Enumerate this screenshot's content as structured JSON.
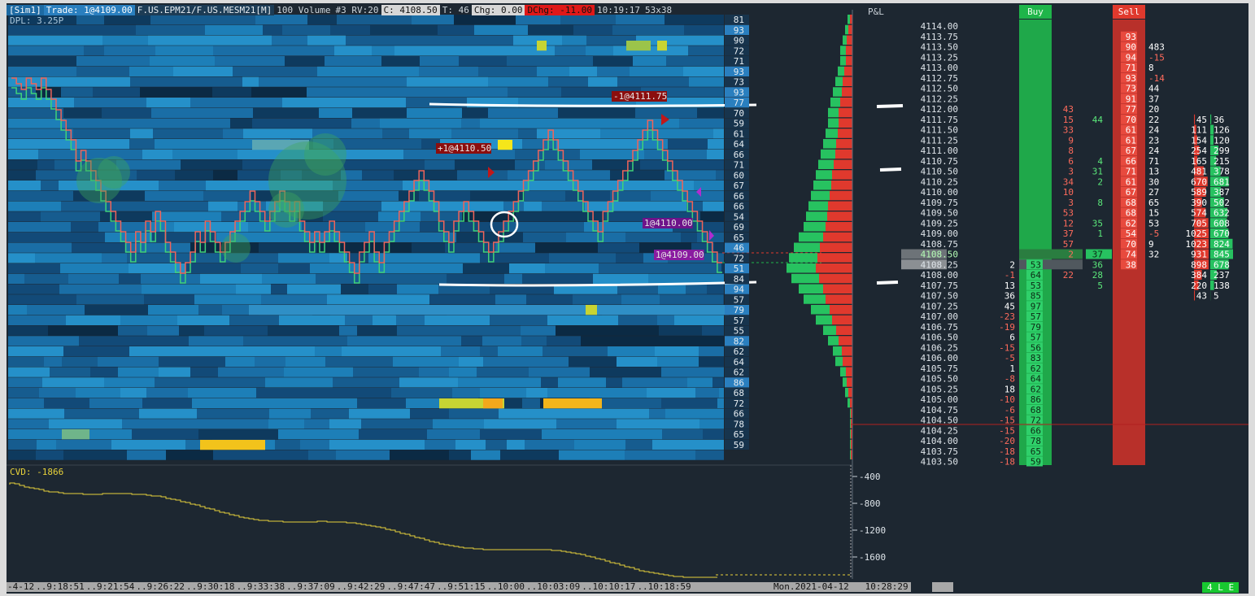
{
  "header": {
    "sim": "[Sim1]",
    "trade": "Trade: 1@4109.00",
    "symbol": "F.US.EPM21/F.US.MESM21[M]",
    "volume": "100 Volume",
    "rv": "#3 RV:20",
    "close": "C: 4108.50",
    "t": "T: 46",
    "chg": "Chg: 0.00",
    "dchg": "DChg: -11.00",
    "time": "10:19:17",
    "grid": "53x38",
    "dpl": "DPL: 3.25P"
  },
  "columns": {
    "pnl": "P&L",
    "buy": "Buy",
    "sell": "Sell"
  },
  "cvd_label": "CVD: -1866",
  "cvd_axis": [
    "-400",
    "-800",
    "-1200",
    "-1600"
  ],
  "right_axis": [
    "81",
    "93",
    "90",
    "72",
    "71",
    "93",
    "73",
    "93",
    "77",
    "70",
    "59",
    "61",
    "64",
    "66",
    "71",
    "60",
    "67",
    "66",
    "66",
    "54",
    "69",
    "65",
    "46",
    "72",
    "51",
    "84",
    "94",
    "57",
    "79",
    "57",
    "55",
    "82",
    "62",
    "64",
    "62",
    "86",
    "68",
    "72",
    "66",
    "78",
    "65",
    "59"
  ],
  "time_axis": [
    "-4-12",
    "9:18:51",
    "9:21:54",
    "9:26:22",
    "9:30:18",
    "9:33:38",
    "9:37:09",
    "9:42:29",
    "9:47:47",
    "9:51:15",
    "10:00",
    "10:03:09",
    "10:10:17",
    "10:18:59"
  ],
  "date_label": "Mon.2021-04-12   10:28:29",
  "status": "4 L E",
  "flags": [
    {
      "text": "-1@4111.75",
      "color": "#8b0e0e"
    },
    {
      "text": "+1@4110.50",
      "color": "#8b0e0e"
    },
    {
      "text": "1@4110.00",
      "color": "#6e138a"
    },
    {
      "text": "1@4109.00",
      "color": "#8a1ba0"
    }
  ],
  "ladder": {
    "prices": [
      "4114.00",
      "4113.75",
      "4113.50",
      "4113.25",
      "4113.00",
      "4112.75",
      "4112.50",
      "4112.25",
      "4112.00",
      "4111.75",
      "4111.50",
      "4111.25",
      "4111.00",
      "4110.75",
      "4110.50",
      "4110.25",
      "4110.00",
      "4109.75",
      "4109.50",
      "4109.25",
      "4109.00",
      "4108.75",
      "4108.50",
      "4108.25",
      "4108.00",
      "4107.75",
      "4107.50",
      "4107.25",
      "4107.00",
      "4106.75",
      "4106.50",
      "4106.25",
      "4106.00",
      "4105.75",
      "4105.50",
      "4105.25",
      "4105.00",
      "4104.75",
      "4104.50",
      "4104.25",
      "4104.00",
      "4103.75",
      "4103.50"
    ],
    "pnl": [
      "",
      "",
      "",
      "",
      "",
      "",
      "",
      "",
      "",
      "",
      "",
      "",
      "",
      "",
      "",
      "",
      "",
      "",
      "",
      "",
      "",
      "",
      "",
      "2",
      "-1",
      "13",
      "36",
      "45",
      "-23",
      "-19",
      "6",
      "-15",
      "-5",
      "1",
      "-8",
      "18",
      "-10",
      "-6",
      "-15",
      "-15",
      "-20",
      "-18",
      "-18"
    ],
    "bid": [
      "",
      "",
      "",
      "",
      "",
      "",
      "",
      "",
      "",
      "",
      "",
      "",
      "",
      "",
      "",
      "",
      "",
      "",
      "",
      "",
      "",
      "",
      "",
      "53",
      "64",
      "53",
      "85",
      "97",
      "57",
      "79",
      "57",
      "56",
      "83",
      "62",
      "64",
      "62",
      "86",
      "68",
      "72",
      "66",
      "78",
      "65",
      "59"
    ],
    "sold": [
      "",
      "",
      "",
      "",
      "",
      "",
      "",
      "",
      "43",
      "15",
      "33",
      "9",
      "8",
      "6",
      "3",
      "34",
      "10",
      "3",
      "53",
      "12",
      "37",
      "57",
      "2",
      "",
      "22",
      "",
      "",
      "",
      "",
      "",
      "",
      "",
      "",
      "",
      "",
      "",
      "",
      "",
      "",
      "",
      "",
      "",
      ""
    ],
    "bought": [
      "",
      "",
      "",
      "",
      "",
      "",
      "",
      "",
      "",
      "44",
      "",
      "",
      "",
      "4",
      "31",
      "2",
      "",
      "8",
      "",
      "35",
      "1",
      "",
      "37",
      "36",
      "28",
      "5",
      "",
      "",
      "",
      "",
      "",
      "",
      "",
      "",
      "",
      "",
      "",
      "",
      "",
      "",
      "",
      "",
      ""
    ],
    "ask": [
      "",
      "93",
      "90",
      "94",
      "71",
      "93",
      "73",
      "91",
      "77",
      "70",
      "61",
      "61",
      "67",
      "66",
      "71",
      "61",
      "67",
      "68",
      "68",
      "62",
      "54",
      "70",
      "74",
      "38",
      "",
      "",
      "",
      "",
      "",
      "",
      "",
      "",
      "",
      "",
      "",
      "",
      "",
      "",
      "",
      "",
      "",
      "",
      ""
    ],
    "vol": [
      "",
      "",
      "483",
      "-15",
      "8",
      "-14",
      "44",
      "37",
      "20",
      "22",
      "24",
      "23",
      "24",
      "71",
      "13",
      "30",
      "27",
      "65",
      "15",
      "53",
      "-5",
      "9",
      "32",
      "",
      "",
      "",
      "",
      "",
      "",
      "",
      "",
      "",
      "",
      "",
      "",
      "",
      "",
      "",
      "",
      "",
      "",
      "",
      ""
    ],
    "vp_a": [
      "",
      "",
      "",
      "",
      "",
      "",
      "",
      "",
      "",
      "45",
      "111",
      "154",
      "254",
      "165",
      "481",
      "670",
      "589",
      "390",
      "574",
      "705",
      "1025",
      "1023",
      "931",
      "898",
      "384",
      "220",
      "43",
      "",
      "",
      "",
      "",
      "",
      "",
      "",
      "",
      "",
      "",
      "",
      "",
      "",
      "",
      "",
      ""
    ],
    "vp_b": [
      "",
      "",
      "",
      "",
      "",
      "",
      "",
      "",
      "",
      "36",
      "126",
      "120",
      "299",
      "215",
      "378",
      "681",
      "387",
      "502",
      "632",
      "608",
      "670",
      "824",
      "845",
      "678",
      "237",
      "138",
      "5",
      "",
      "",
      "",
      "",
      "",
      "",
      "",
      "",
      "",
      "",
      "",
      "",
      "",
      "",
      "",
      ""
    ]
  },
  "profile": [
    2,
    3,
    4,
    5,
    5,
    6,
    7,
    8,
    9,
    10,
    10,
    11,
    12,
    13,
    14,
    15,
    16,
    17,
    18,
    19,
    20,
    22,
    24,
    26,
    27,
    25,
    22,
    20,
    17,
    15,
    12,
    10,
    8,
    7,
    5,
    4,
    3,
    2,
    1,
    1,
    1,
    1,
    1
  ],
  "colors": {
    "bg": "#1c2630",
    "buy": "#1fb54a",
    "sell": "#e0392d",
    "cvd": "#e8d23a"
  }
}
